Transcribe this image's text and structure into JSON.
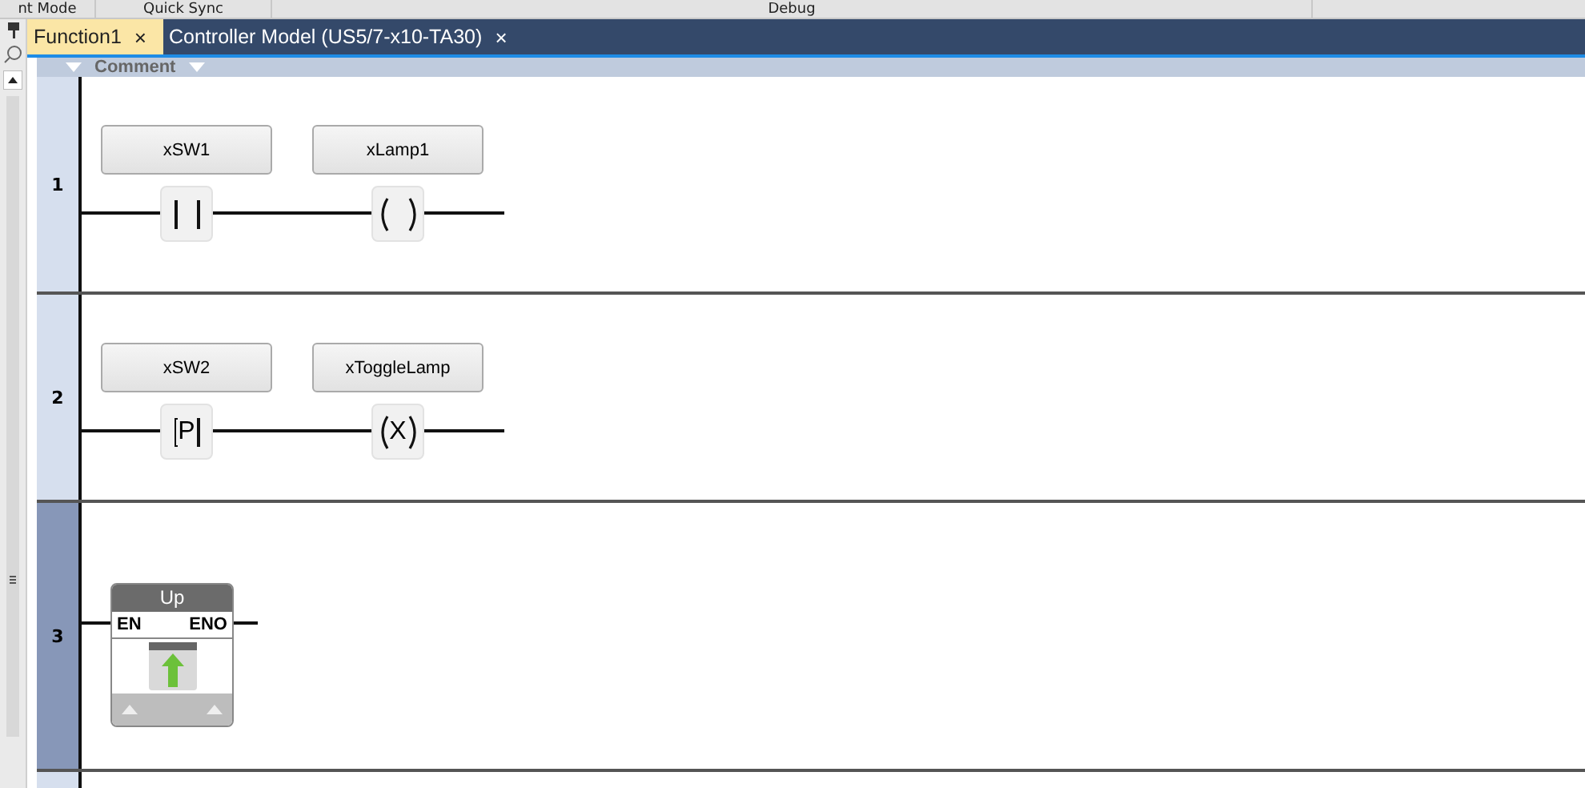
{
  "top_strip": [
    "nt Mode",
    "Quick Sync",
    "Debug"
  ],
  "tabs": [
    {
      "label": "Function1",
      "close": "×",
      "selected": true
    },
    {
      "label": "Controller Model (US5/7-x10-TA30)",
      "close": "×",
      "selected": false
    }
  ],
  "comment_bar": {
    "label": "Comment"
  },
  "rungs": [
    {
      "number": "1",
      "selected": false,
      "elements": [
        {
          "kind": "contact",
          "variable": "xSW1"
        },
        {
          "kind": "coil",
          "variable": "xLamp1"
        }
      ]
    },
    {
      "number": "2",
      "selected": false,
      "elements": [
        {
          "kind": "contact",
          "variable": "xSW2",
          "modifier": "P"
        },
        {
          "kind": "coil",
          "variable": "xToggleLamp",
          "modifier": "X"
        }
      ]
    },
    {
      "number": "3",
      "selected": true,
      "elements": [
        {
          "kind": "function_block",
          "title": "Up",
          "input": "EN",
          "output": "ENO"
        }
      ]
    }
  ]
}
